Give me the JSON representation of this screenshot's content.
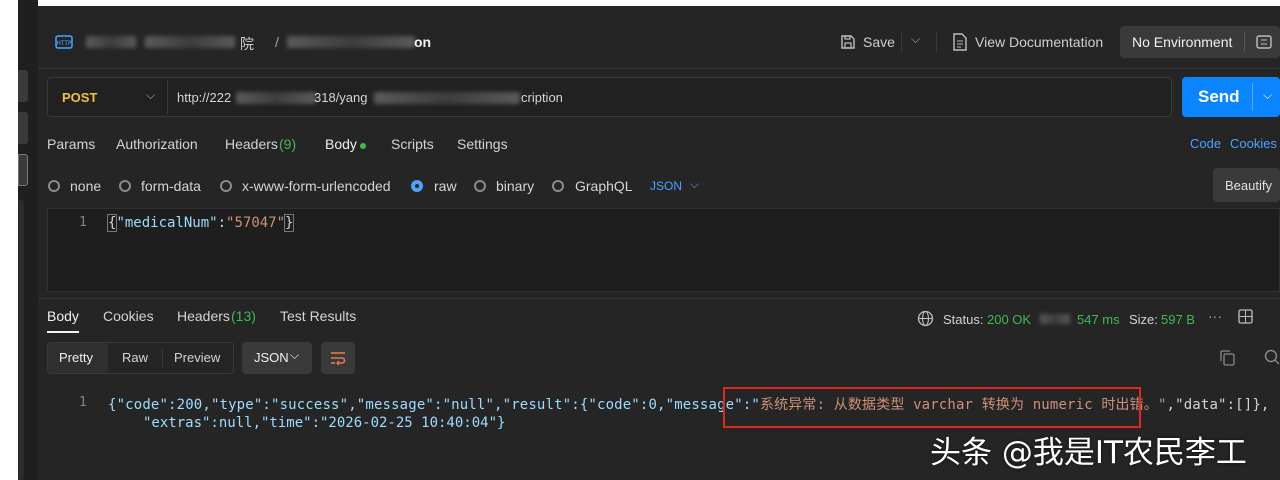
{
  "header": {
    "breadcrumb_sep": "/",
    "crumb_end": "on",
    "crumb_mid": "院",
    "save_label": "Save",
    "view_docs_label": "View Documentation",
    "environment_label": "No Environment"
  },
  "request": {
    "method": "POST",
    "url_start": "http://222",
    "url_mid": "318/yang",
    "url_end": "cription",
    "send_label": "Send",
    "tabs": {
      "params": "Params",
      "authorization": "Authorization",
      "headers": "Headers",
      "headers_count": "(9)",
      "body": "Body",
      "scripts": "Scripts",
      "settings": "Settings"
    },
    "code_link": "Code",
    "cookies_link": "Cookies",
    "body_types": {
      "none": "none",
      "form_data": "form-data",
      "urlencoded": "x-www-form-urlencoded",
      "raw": "raw",
      "binary": "binary",
      "graphql": "GraphQL",
      "format": "JSON"
    },
    "beautify_label": "Beautify",
    "editor": {
      "line_no": "1",
      "brace_open": "{",
      "key": "\"medicalNum\"",
      "colon": ":",
      "value": "\"57047\"",
      "brace_close": "}"
    }
  },
  "response": {
    "tabs": {
      "body": "Body",
      "cookies": "Cookies",
      "headers": "Headers",
      "headers_count": "(13)",
      "test_results": "Test Results"
    },
    "status_label": "Status:",
    "status_value": "200 OK",
    "time_value": "547 ms",
    "size_label": "Size:",
    "size_value": "597 B",
    "view_modes": {
      "pretty": "Pretty",
      "raw": "Raw",
      "preview": "Preview"
    },
    "format": "JSON",
    "body": {
      "line_no": "1",
      "line1_part1": "{\"code\":200,\"type\":\"success\",\"message\":\"null\",\"result\":{\"code\":0,\"message\":\"",
      "error_message": "系统异常: 从数据类型 varchar 转换为 numeric 时出错。\"",
      "line1_part2": ",\"data\":[]},",
      "line2": "\"extras\":null,\"time\":\"2026-02-25 10:40:04\"}"
    }
  },
  "watermark": "头条 @我是IT农民李工",
  "colors": {
    "accent_blue": "#0a84ff",
    "method_yellow": "#f0c23b",
    "status_green": "#3fb950",
    "json_key": "#9cdcfe",
    "json_string": "#ce9178",
    "error_box": "#e0281d"
  }
}
